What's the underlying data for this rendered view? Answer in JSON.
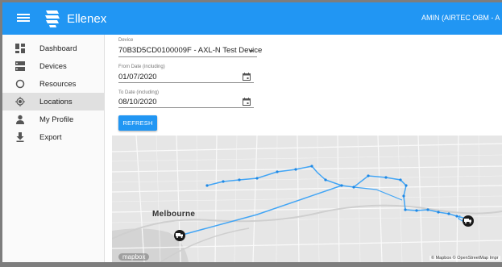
{
  "app": {
    "title": "Ellenex",
    "user": "AMIN (AIRTEC OBM - A"
  },
  "sidebar": {
    "items": [
      {
        "label": "Dashboard",
        "icon": "dashboard-icon"
      },
      {
        "label": "Devices",
        "icon": "devices-icon"
      },
      {
        "label": "Resources",
        "icon": "resources-icon"
      },
      {
        "label": "Locations",
        "icon": "location-icon",
        "active": true
      },
      {
        "label": "My Profile",
        "icon": "person-icon"
      },
      {
        "label": "Export",
        "icon": "download-icon"
      }
    ]
  },
  "form": {
    "device": {
      "label": "Device",
      "value": "70B3D5CD0100009F - AXL-N Test Device"
    },
    "from_date": {
      "label": "From Date (including)",
      "value": "01/07/2020"
    },
    "to_date": {
      "label": "To Date (including)",
      "value": "08/10/2020"
    },
    "refresh_label": "REFRESH"
  },
  "map": {
    "city": "Melbourne",
    "logo": "mapbox",
    "attribution": "© Mapbox © OpenStreetMap Impr",
    "route_color": "#42a5f5",
    "marker_icon": "truck-icon"
  },
  "colors": {
    "primary": "#2196f3",
    "active_nav": "#e0e0e0"
  }
}
